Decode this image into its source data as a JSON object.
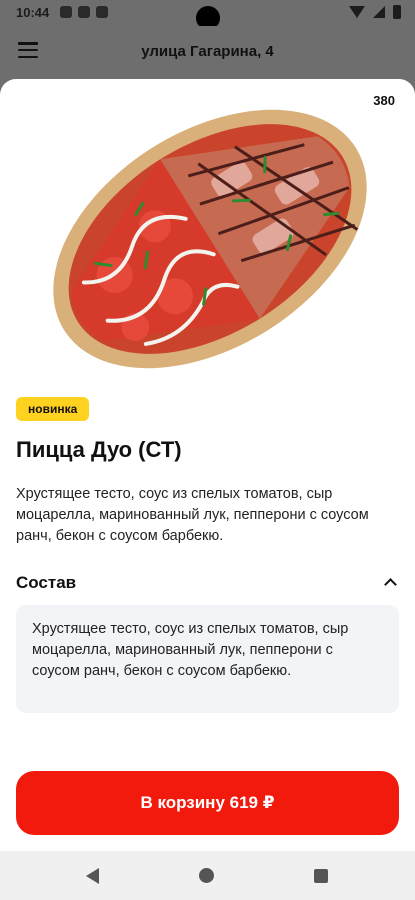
{
  "status_bar": {
    "time": "10:44",
    "icons": [
      "gear-icon",
      "assistant-icon",
      "sim-icon",
      "wifi-icon",
      "signal-icon",
      "battery-icon"
    ]
  },
  "app_bar": {
    "address": "улица Гагарина, 4",
    "menu_icon": "hamburger-icon"
  },
  "product": {
    "weight": "380",
    "badge": "новинка",
    "name": "Пицца Дуо (СТ)",
    "description": "Хрустящее тесто, соус из спелых томатов, сыр моцарелла, маринованный лук, пепперони с соусом ранч, бекон с соусом барбекю.",
    "image": "pizza-duo-image"
  },
  "composition": {
    "title": "Состав",
    "expanded": true,
    "text": "Хрустящее тесто, соус из спелых томатов, сыр моцарелла, маринованный лук, пепперони с соусом ранч, бекон с соусом барбекю."
  },
  "cart_button": {
    "label": "В корзину 619 ₽"
  },
  "colors": {
    "accent": "#f21a0c",
    "badge": "#ffd21f",
    "overlay": "#6e6e6e",
    "composition_bg": "#f3f4f8"
  },
  "nav_bar": {
    "icons": [
      "back-icon",
      "home-icon",
      "recent-apps-icon"
    ]
  }
}
